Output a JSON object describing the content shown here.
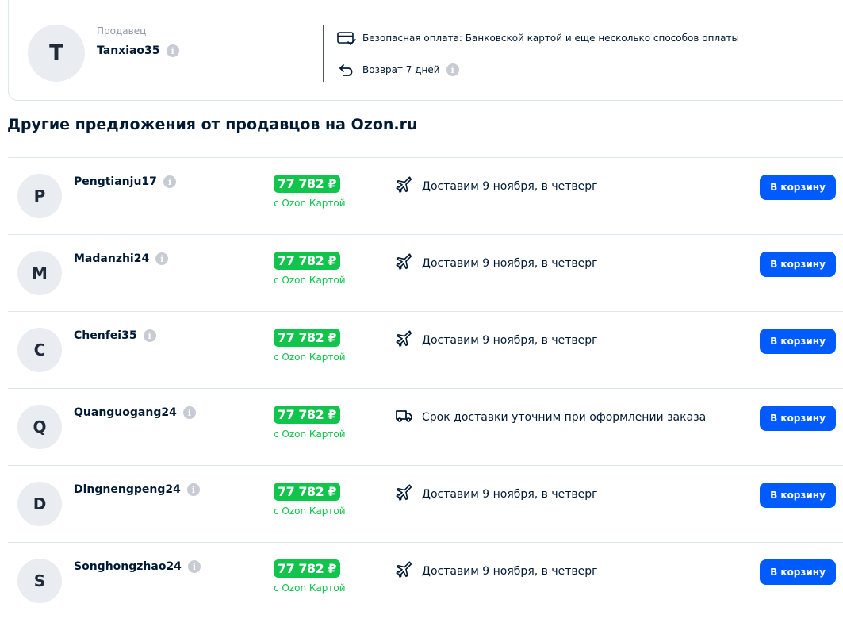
{
  "seller": {
    "avatar_letter": "T",
    "label": "Продавец",
    "name": "Tanxiao35",
    "payment_text": "Безопасная оплата: Банковской картой и еще несколько способов оплаты",
    "return_text": "Возврат 7 дней"
  },
  "section_title": "Другие предложения от продавцов на Ozon.ru",
  "offers": [
    {
      "letter": "P",
      "name": "Pengtianju17",
      "price": "77 782 ₽",
      "price_note": "с Ozon Картой",
      "delivery_icon": "plane-icon",
      "delivery": "Доставим 9 ноября, в четверг",
      "button": "В корзину"
    },
    {
      "letter": "M",
      "name": "Madanzhi24",
      "price": "77 782 ₽",
      "price_note": "с Ozon Картой",
      "delivery_icon": "plane-icon",
      "delivery": "Доставим 9 ноября, в четверг",
      "button": "В корзину"
    },
    {
      "letter": "C",
      "name": "Chenfei35",
      "price": "77 782 ₽",
      "price_note": "с Ozon Картой",
      "delivery_icon": "plane-icon",
      "delivery": "Доставим 9 ноября, в четверг",
      "button": "В корзину"
    },
    {
      "letter": "Q",
      "name": "Quanguogang24",
      "price": "77 782 ₽",
      "price_note": "с Ozon Картой",
      "delivery_icon": "truck-icon",
      "delivery": "Срок доставки уточним при оформлении заказа",
      "button": "В корзину"
    },
    {
      "letter": "D",
      "name": "Dingnengpeng24",
      "price": "77 782 ₽",
      "price_note": "с Ozon Картой",
      "delivery_icon": "plane-icon",
      "delivery": "Доставим 9 ноября, в четверг",
      "button": "В корзину"
    },
    {
      "letter": "S",
      "name": "Songhongzhao24",
      "price": "77 782 ₽",
      "price_note": "с Ozon Картой",
      "delivery_icon": "plane-icon",
      "delivery": "Доставим 9 ноября, в четверг",
      "button": "В корзину"
    }
  ],
  "colors": {
    "accent": "#005bff",
    "price_green": "#10c44c",
    "text": "#001a34",
    "muted": "#8c96a3"
  }
}
